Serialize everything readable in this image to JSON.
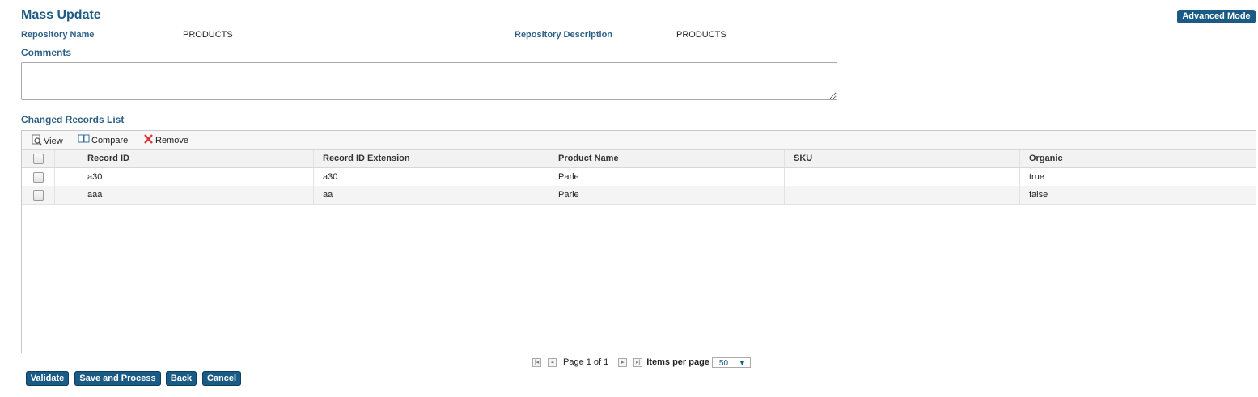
{
  "page": {
    "title": "Mass Update",
    "advanced_mode_label": "Advanced Mode"
  },
  "repository": {
    "name_label": "Repository Name",
    "name_value": "PRODUCTS",
    "description_label": "Repository Description",
    "description_value": "PRODUCTS"
  },
  "comments": {
    "label": "Comments",
    "value": ""
  },
  "changed_records": {
    "title": "Changed Records List",
    "toolbar": {
      "view_label": "View",
      "compare_label": "Compare",
      "remove_label": "Remove"
    },
    "columns": [
      "Record ID",
      "Record ID Extension",
      "Product Name",
      "SKU",
      "Organic"
    ],
    "rows": [
      {
        "record_id": "a30",
        "record_id_extension": "a30",
        "product_name": "Parle",
        "sku": "",
        "organic": "true"
      },
      {
        "record_id": "aaa",
        "record_id_extension": "aa",
        "product_name": "Parle",
        "sku": "",
        "organic": "false"
      }
    ]
  },
  "pager": {
    "page_text": "Page 1 of 1",
    "items_per_page_label": "Items per page",
    "items_per_page_value": "50"
  },
  "actions": {
    "validate_label": "Validate",
    "save_process_label": "Save and Process",
    "back_label": "Back",
    "cancel_label": "Cancel"
  },
  "colors": {
    "accent": "#1a5b86",
    "label": "#2c5f86"
  }
}
